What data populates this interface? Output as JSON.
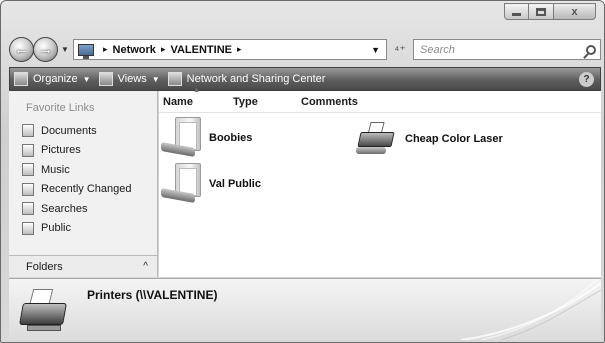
{
  "window": {
    "caption_buttons": {
      "minimize_icon": "minimize-icon",
      "maximize_icon": "maximize-icon",
      "close_symbol": "x"
    }
  },
  "address_bar": {
    "back_icon": "back-arrow-icon",
    "forward_icon": "forward-arrow-icon",
    "breadcrumbs": [
      "Network",
      "VALENTINE"
    ],
    "separator": "▸",
    "refresh_symbol": "⁴⁺",
    "search_placeholder": "Search"
  },
  "toolbar": {
    "organize_label": "Organize",
    "views_label": "Views",
    "network_sharing_label": "Network and Sharing Center",
    "help_symbol": "?"
  },
  "nav_pane": {
    "heading": "Favorite Links",
    "items": [
      {
        "label": "Documents",
        "icon": "documents-icon"
      },
      {
        "label": "Pictures",
        "icon": "pictures-icon"
      },
      {
        "label": "Music",
        "icon": "music-icon"
      },
      {
        "label": "Recently Changed",
        "icon": "recently-changed-icon"
      },
      {
        "label": "Searches",
        "icon": "searches-icon"
      },
      {
        "label": "Public",
        "icon": "public-icon"
      }
    ],
    "folders_label": "Folders",
    "folders_chevron": "^"
  },
  "content": {
    "columns": [
      "Name",
      "Type",
      "Comments"
    ],
    "items": [
      {
        "label": "Boobies",
        "kind": "shared-folder"
      },
      {
        "label": "Val Public",
        "kind": "shared-folder"
      },
      {
        "label": "Cheap Color Laser",
        "kind": "printer"
      }
    ]
  },
  "details_pane": {
    "title": "Printers (\\\\VALENTINE)"
  }
}
